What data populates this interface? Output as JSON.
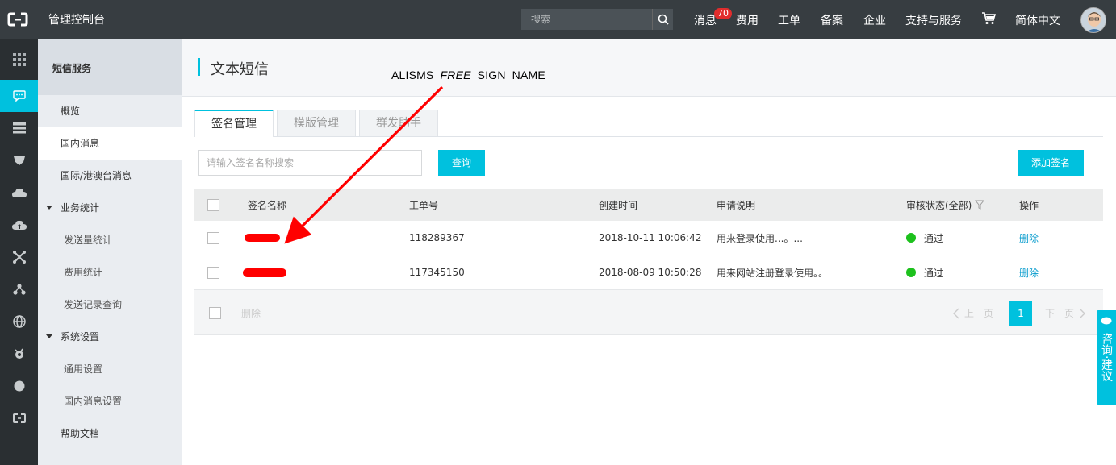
{
  "topbar": {
    "title": "管理控制台",
    "search_placeholder": "搜索",
    "nav": [
      {
        "label": "消息"
      },
      {
        "label": "费用"
      },
      {
        "label": "工单"
      },
      {
        "label": "备案"
      },
      {
        "label": "企业"
      },
      {
        "label": "支持与服务"
      },
      {
        "label": "简体中文"
      }
    ],
    "message_badge": "70"
  },
  "sidebar_icons": [
    "grid-icon",
    "sms-icon",
    "server-icon",
    "shield-icon",
    "cloud-icon",
    "cloud-upload-icon",
    "network-icon",
    "cluster-icon",
    "globe-icon",
    "gear-icon",
    "circle-icon",
    "logo-small-icon"
  ],
  "submenu": {
    "header": "短信服务",
    "items": [
      {
        "label": "概览"
      },
      {
        "label": "国内消息"
      },
      {
        "label": "国际/港澳台消息"
      },
      {
        "label": "业务统计"
      },
      {
        "label": "发送量统计"
      },
      {
        "label": "费用统计"
      },
      {
        "label": "发送记录查询"
      },
      {
        "label": "系统设置"
      },
      {
        "label": "通用设置"
      },
      {
        "label": "国内消息设置"
      },
      {
        "label": "帮助文档"
      }
    ]
  },
  "main": {
    "title": "文本短信",
    "annotation_prefix": "ALISMS_",
    "annotation_italic": "FREE",
    "annotation_suffix": "_SIGN_NAME",
    "tabs": [
      {
        "label": "签名管理"
      },
      {
        "label": "模版管理"
      },
      {
        "label": "群发助手"
      }
    ],
    "filter_placeholder": "请输入签名名称搜索",
    "query_label": "查询",
    "add_label": "添加签名",
    "table": {
      "headers": [
        "签名名称",
        "工单号",
        "创建时间",
        "申请说明",
        "审核状态(全部)",
        "操作"
      ],
      "rows": [
        {
          "ticket": "118289367",
          "created": "2018-10-11 10:06:42",
          "desc": "用来登录使用...。...",
          "status": "通过",
          "action": "删除"
        },
        {
          "ticket": "117345150",
          "created": "2018-08-09 10:50:28",
          "desc": "用来网站注册登录使用。。",
          "status": "通过",
          "action": "删除"
        }
      ]
    },
    "footer": {
      "delete_label": "删除",
      "prev_label": "上一页",
      "page": "1",
      "next_label": "下一页"
    }
  },
  "float_help": {
    "label": "咨询·建议"
  },
  "colors": {
    "accent": "#00c1de",
    "topbar": "#373d41",
    "iconbar": "#2a2f32",
    "success": "#1dc11d",
    "annotation_arrow": "#ff0000"
  }
}
